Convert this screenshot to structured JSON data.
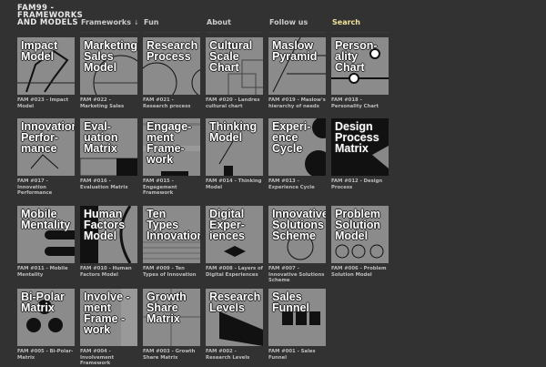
{
  "logo": "FAM99 - FRAMEWORKS AND MODELS",
  "nav": {
    "frameworks": "Frameworks",
    "arrow": "↓",
    "fun": "Fun",
    "about": "About",
    "follow": "Follow us",
    "search": "Search"
  },
  "accent": "#efe29a",
  "tiles": [
    {
      "title": "Impact\nModel",
      "caption": "FAM #023 - Impact Model"
    },
    {
      "title": "Marketing\nSales\nModel",
      "caption": "FAM #022 - Marketing Sales"
    },
    {
      "title": "Research\nProcess",
      "caption": "FAM #021 - Research process"
    },
    {
      "title": "Cultural\nScale\nChart",
      "caption": "FAM #020 - Landres cultural chart"
    },
    {
      "title": "Maslow\nPyramid",
      "caption": "FAM #019 - Maslow's hierarchy of needs"
    },
    {
      "title": "Person-\nality\nChart",
      "caption": "FAM #018 - Personality Chart"
    },
    {
      "title": "Innovation\nPerfor-\nmance",
      "caption": "FAM #017 - Innovation Performance"
    },
    {
      "title": "Eval-\nuation\nMatrix",
      "caption": "FAM #016 - Evaluation Matrix"
    },
    {
      "title": "Engage-\nment\nFrame-\nwork",
      "caption": "FAM #015 - Engagement Framework"
    },
    {
      "title": "Thinking\nModel",
      "caption": "FAM #014 - Thinking Model"
    },
    {
      "title": "Experi-\nence\nCycle",
      "caption": "FAM #013 - Experience Cycle"
    },
    {
      "title": "Design\nProcess\nMatrix",
      "caption": "FAM #012 - Design Process"
    },
    {
      "title": "Mobile\nMentality",
      "caption": "FAM #011 - Mobile Mentality"
    },
    {
      "title": "Human\nFactors\nModel",
      "caption": "FAM #010 - Human Factors Model"
    },
    {
      "title": "Ten\nTypes\nInnovation",
      "caption": "FAM #009 - Ten Types of Innovation"
    },
    {
      "title": "Digital\nExper-\niences",
      "caption": "FAM #008 - Layers of Digital Experiences"
    },
    {
      "title": "Innovative\nSolutions\nScheme",
      "caption": "FAM #007 - Innovative Solutions Scheme"
    },
    {
      "title": "Problem\nSolution\nModel",
      "caption": "FAM #006 - Problem Solution Model"
    },
    {
      "title": "Bi-Polar\nMatrix",
      "caption": "FAM #005 - Bi-Polar-Matrix"
    },
    {
      "title": "Involve -\nment\nFrame -\nwork",
      "caption": "FAM #004 - Involvement Framework"
    },
    {
      "title": "Growth\nShare\nMatrix",
      "caption": "FAM #003 - Growth Share Matrix"
    },
    {
      "title": "Research\nLevels",
      "caption": "FAM #002 - Research Levels"
    },
    {
      "title": "Sales\nFunnel",
      "caption": "FAM #001 - Sales Funnel"
    }
  ]
}
